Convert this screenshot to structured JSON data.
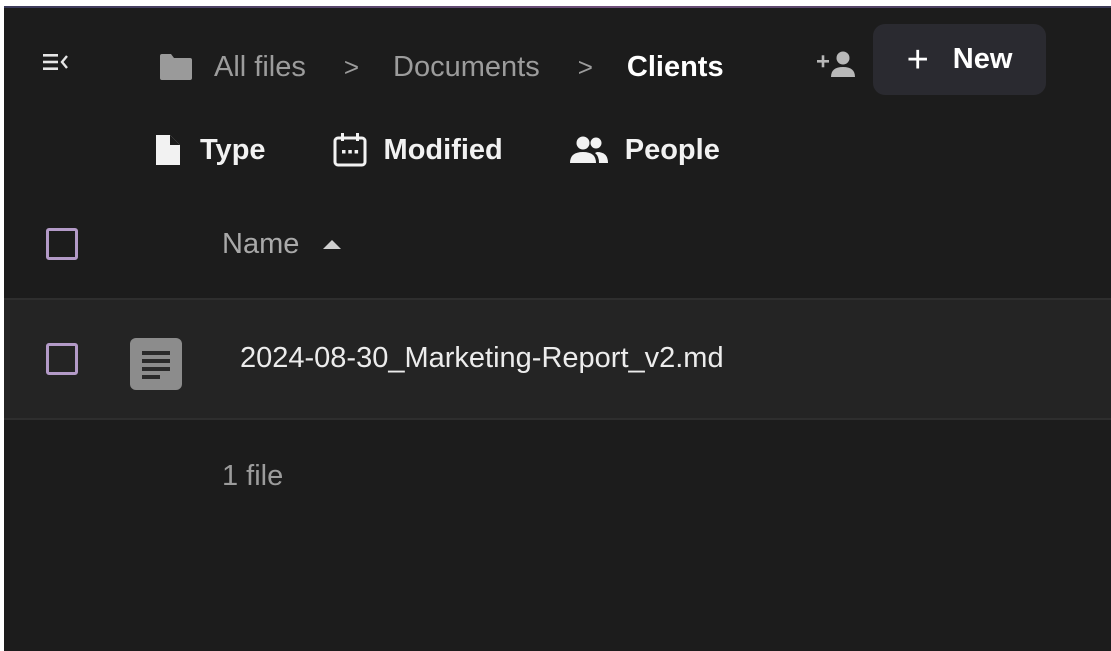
{
  "header": {
    "breadcrumb": [
      {
        "label": "All files",
        "icon": "folder-icon"
      },
      {
        "label": "Documents"
      },
      {
        "label": "Clients",
        "current": true
      }
    ],
    "separator": ">",
    "new_button": {
      "plus": "+",
      "label": "New"
    }
  },
  "filters": [
    {
      "label": "Type",
      "icon": "file-icon"
    },
    {
      "label": "Modified",
      "icon": "calendar-icon"
    },
    {
      "label": "People",
      "icon": "people-icon"
    }
  ],
  "table": {
    "column_name": "Name",
    "rows": [
      {
        "name": "2024-08-30_Marketing-Report_v2.md",
        "icon": "document-icon"
      }
    ],
    "footer": "1 file"
  },
  "colors": {
    "background": "#1c1c1c",
    "checkbox_border": "#b39ac7",
    "new_button_bg": "#2a2a30",
    "row_bg": "#242424"
  }
}
